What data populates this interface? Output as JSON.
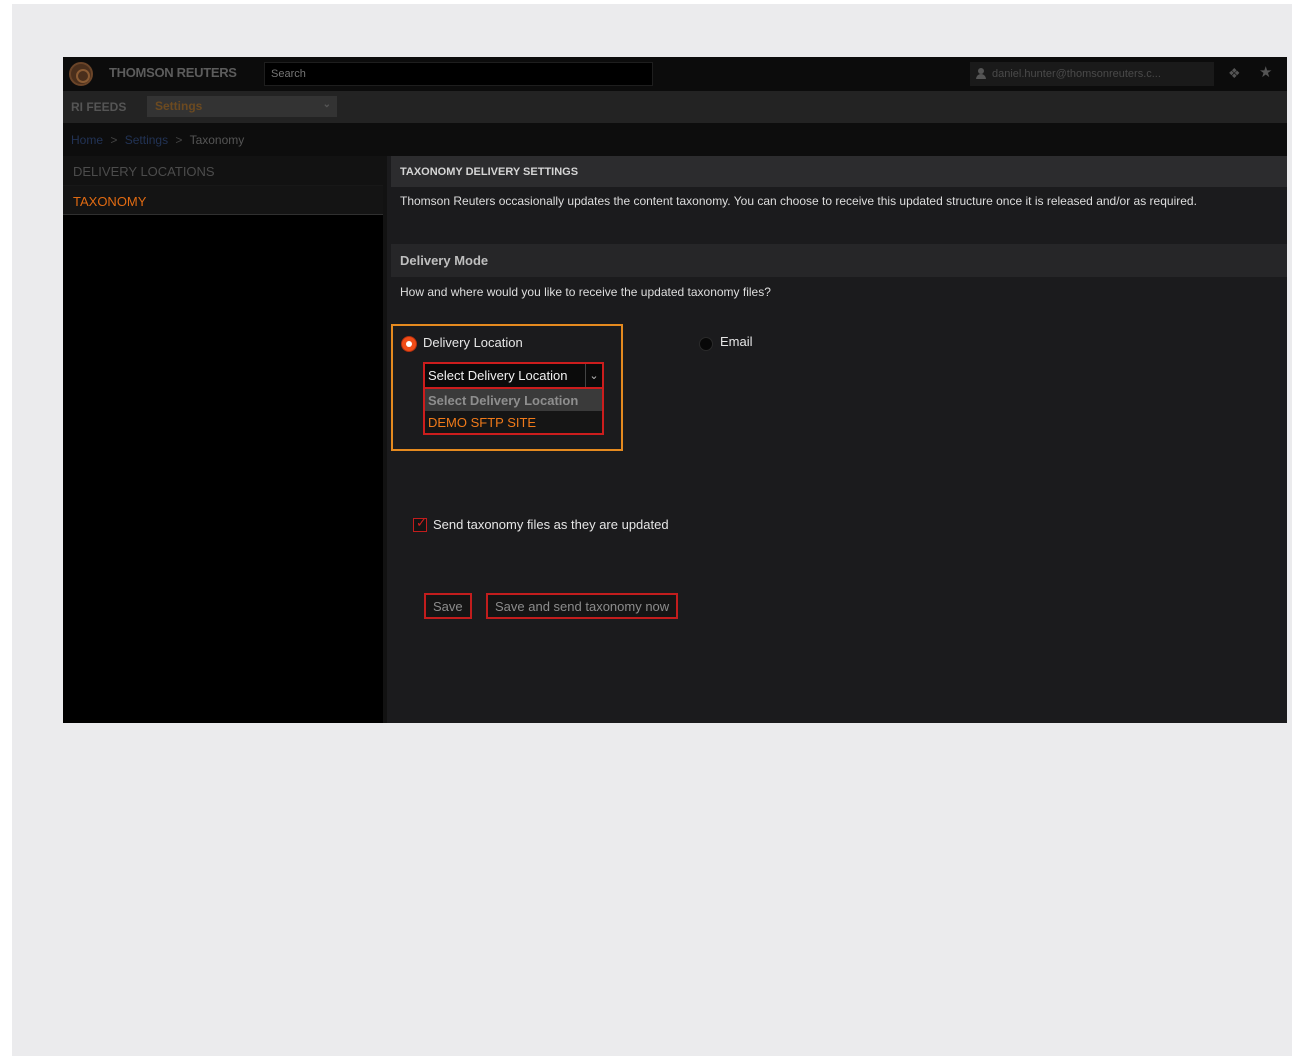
{
  "topbar": {
    "brand": "THOMSON REUTERS",
    "search_placeholder": "Search",
    "user": "daniel.hunter@thomsonreuters.c..."
  },
  "subbar": {
    "feeds_label": "RI FEEDS",
    "section_value": "Settings"
  },
  "breadcrumb": {
    "home": "Home",
    "settings": "Settings",
    "current": "Taxonomy",
    "separator": ">"
  },
  "sidebar": {
    "items": [
      {
        "label": "DELIVERY LOCATIONS"
      },
      {
        "label": "TAXONOMY"
      }
    ]
  },
  "main": {
    "header": "TAXONOMY DELIVERY SETTINGS",
    "description": "Thomson Reuters occasionally updates the content taxonomy. You can choose to receive this updated structure once it is released and/or as required.",
    "mode_header": "Delivery Mode",
    "question": "How and where would you like to receive the updated taxonomy files?",
    "options": {
      "delivery_location": "Delivery Location",
      "email": "Email"
    },
    "location_select": {
      "value": "Select Delivery Location",
      "dropdown_options": [
        "Select Delivery Location",
        "DEMO SFTP SITE"
      ]
    },
    "send_checkbox": {
      "label": "Send taxonomy files as they are updated",
      "checked": true
    },
    "buttons": {
      "save": "Save",
      "save_and_send": "Save and send taxonomy now"
    }
  },
  "colors": {
    "accent_orange": "#e06a12",
    "error_red": "#cc1d1d",
    "highlight_box": "#e58a1f"
  }
}
